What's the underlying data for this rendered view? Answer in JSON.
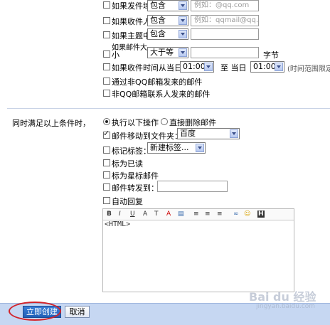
{
  "conditions": {
    "sender_domain": {
      "label": "如果发件域",
      "op": "包含",
      "placeholder": "例如：@qq.com"
    },
    "recipient": {
      "label": "如果收件人",
      "op": "包含",
      "placeholder": "例如：qqmail@qq.c"
    },
    "subject": {
      "label": "如果主题中",
      "op": "包含",
      "placeholder": ""
    },
    "size": {
      "label_line1": "如果邮件大",
      "label_line2": "小",
      "op": "大于等",
      "unit": "字节"
    },
    "time": {
      "label": "如果收件时间从当日",
      "from": "01:00",
      "to_label": "至 当日",
      "to": "01:00",
      "note": "(时间范围限定"
    },
    "non_qq": {
      "label": "通过非QQ邮箱发来的邮件"
    },
    "non_contact": {
      "label": "非QQ邮箱联系人发来的邮件"
    }
  },
  "actions": {
    "prefix": "同时满足以上条件时，",
    "radio_execute": "执行以下操作",
    "radio_delete": "直接删除邮件",
    "move_to_folder": {
      "label": "邮件移动到文件夹：",
      "value": "百度",
      "checked": true
    },
    "tag": {
      "label": "标记标签：",
      "value": "新建标签..."
    },
    "mark_read": "标为已读",
    "mark_star": "标为星标邮件",
    "forward": {
      "label": "邮件转发到："
    },
    "auto_reply": "自动回复"
  },
  "editor": {
    "toolbar": [
      "B",
      "I",
      "U",
      "A",
      "T",
      "A",
      "▤",
      "≡",
      "≡",
      "≡",
      "∞",
      "☺",
      "H"
    ],
    "content": "<HTML>"
  },
  "footer": {
    "create_label": "立即创建",
    "cancel_label": "取消"
  },
  "watermark": {
    "brand": "Bai du 经验",
    "url": "jingyan.baidu.com"
  },
  "colors": {
    "footer_bg": "#c6d7f2",
    "highlight_circle": "#d2232a",
    "separator": "#c8d3e6"
  }
}
